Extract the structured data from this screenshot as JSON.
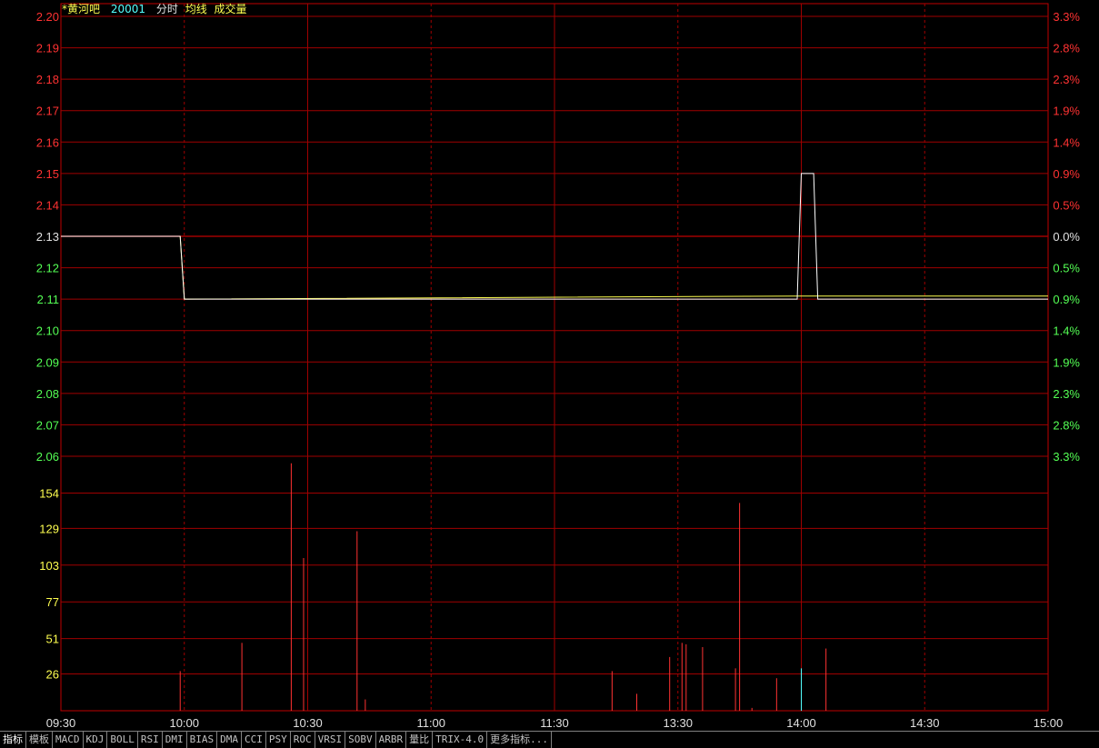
{
  "header": {
    "stock_name": "*黄河吧",
    "stock_code": "20001",
    "view_mode": "分时",
    "avg_line_label": "均线",
    "volume_label": "成交量"
  },
  "colors": {
    "background": "#000000",
    "grid": "#a00000",
    "frame": "#c00000",
    "up": "#ff3232",
    "down": "#54ff54",
    "flat": "#e0e0e0",
    "price_line": "#ffffff",
    "avg_line": "#ffff50",
    "volume_bar": "#ff3232",
    "volume_bar_alt": "#54ffff",
    "time_label": "#e0e0e0",
    "title_name": "#ffff50",
    "title_code": "#54ffff"
  },
  "chart_data": {
    "type": "line",
    "session": "intraday",
    "x_ticks": [
      "09:30",
      "10:00",
      "10:30",
      "11:00",
      "11:30",
      "13:30",
      "14:00",
      "14:30",
      "15:00"
    ],
    "prev_close": 2.13,
    "price_axis": {
      "ylim": [
        2.06,
        2.2
      ],
      "ticks": [
        "2.20",
        "2.19",
        "2.18",
        "2.17",
        "2.16",
        "2.15",
        "2.14",
        "2.13",
        "2.12",
        "2.11",
        "2.10",
        "2.09",
        "2.08",
        "2.07",
        "2.06"
      ],
      "pct_ticks": [
        "3.3%",
        "2.8%",
        "2.3%",
        "1.9%",
        "1.4%",
        "0.9%",
        "0.5%",
        "0.0%",
        "0.5%",
        "0.9%",
        "1.4%",
        "1.9%",
        "2.3%",
        "2.8%",
        "3.3%"
      ]
    },
    "price_series": {
      "name": "",
      "points": [
        {
          "t": 0,
          "price": 2.13
        },
        {
          "t": 29,
          "price": 2.13
        },
        {
          "t": 30,
          "price": 2.11
        },
        {
          "t": 179,
          "price": 2.11
        },
        {
          "t": 180,
          "price": 2.15
        },
        {
          "t": 183,
          "price": 2.15
        },
        {
          "t": 184,
          "price": 2.11
        },
        {
          "t": 240,
          "price": 2.11
        }
      ]
    },
    "avg_series": {
      "name": "",
      "points": [
        {
          "t": 0,
          "price": 2.13
        },
        {
          "t": 29,
          "price": 2.13
        },
        {
          "t": 30,
          "price": 2.11
        },
        {
          "t": 180,
          "price": 2.111
        },
        {
          "t": 240,
          "price": 2.111
        }
      ]
    },
    "volume_axis": {
      "ylim": [
        0,
        180
      ],
      "ticks": [
        "154",
        "129",
        "103",
        "77",
        "51",
        "26"
      ]
    },
    "volume": [
      {
        "t": 29,
        "v": 28
      },
      {
        "t": 44,
        "v": 48
      },
      {
        "t": 56,
        "v": 175
      },
      {
        "t": 59,
        "v": 108
      },
      {
        "t": 72,
        "v": 127
      },
      {
        "t": 74,
        "v": 8
      },
      {
        "t": 134,
        "v": 28
      },
      {
        "t": 140,
        "v": 12
      },
      {
        "t": 148,
        "v": 38
      },
      {
        "t": 151,
        "v": 48
      },
      {
        "t": 152,
        "v": 47
      },
      {
        "t": 156,
        "v": 45
      },
      {
        "t": 164,
        "v": 30
      },
      {
        "t": 165,
        "v": 147
      },
      {
        "t": 168,
        "v": 2
      },
      {
        "t": 174,
        "v": 23
      },
      {
        "t": 180,
        "v": 30,
        "alt": true
      },
      {
        "t": 186,
        "v": 44
      }
    ]
  },
  "indicator_tabs": [
    "指标",
    "模板",
    "MACD",
    "KDJ",
    "BOLL",
    "RSI",
    "DMI",
    "BIAS",
    "DMA",
    "CCI",
    "PSY",
    "ROC",
    "VRSI",
    "SOBV",
    "ARBR",
    "量比",
    "TRIX-4.0",
    "更多指标..."
  ]
}
